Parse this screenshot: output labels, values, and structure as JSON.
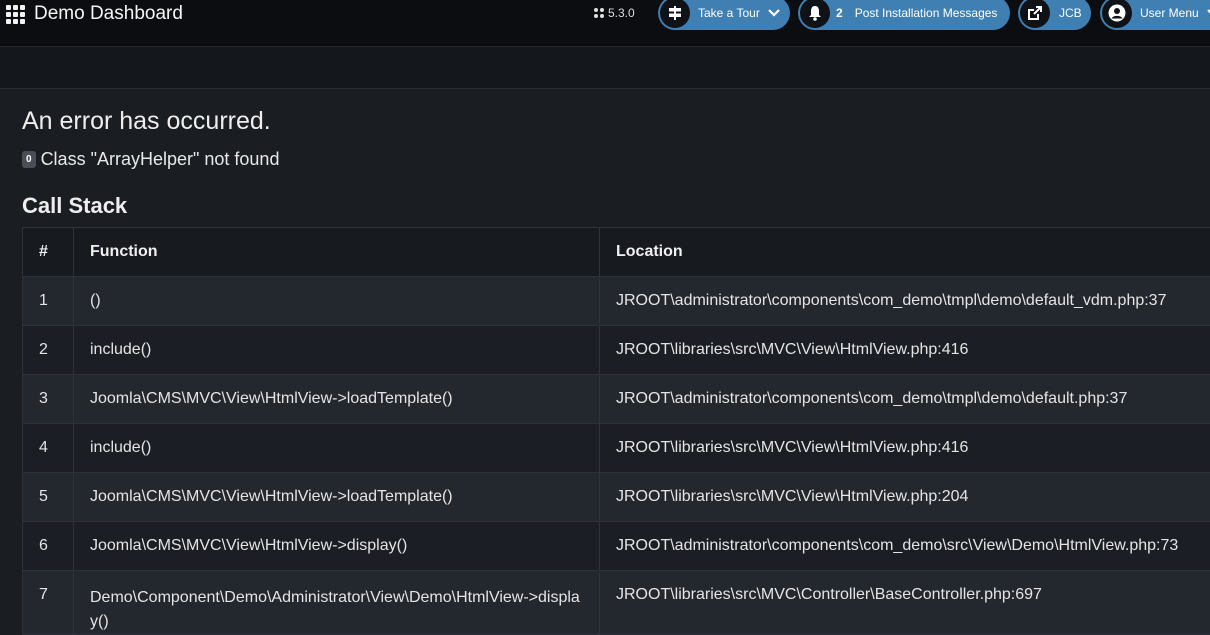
{
  "header": {
    "title": "Demo Dashboard",
    "version": "5.3.0",
    "tour_label": "Take a Tour",
    "messages_count": "2",
    "messages_label": "Post Installation Messages",
    "jcb_label": "JCB",
    "user_menu_label": "User Menu"
  },
  "error": {
    "title": "An error has occurred.",
    "code": "0",
    "message": "Class \"ArrayHelper\" not found"
  },
  "call_stack": {
    "title": "Call Stack",
    "columns": [
      "#",
      "Function",
      "Location"
    ],
    "rows": [
      {
        "n": "1",
        "function": "()",
        "location": "JROOT\\administrator\\components\\com_demo\\tmpl\\demo\\default_vdm.php:37"
      },
      {
        "n": "2",
        "function": "include()",
        "location": "JROOT\\libraries\\src\\MVC\\View\\HtmlView.php:416"
      },
      {
        "n": "3",
        "function": "Joomla\\CMS\\MVC\\View\\HtmlView->loadTemplate()",
        "location": "JROOT\\administrator\\components\\com_demo\\tmpl\\demo\\default.php:37"
      },
      {
        "n": "4",
        "function": "include()",
        "location": "JROOT\\libraries\\src\\MVC\\View\\HtmlView.php:416"
      },
      {
        "n": "5",
        "function": "Joomla\\CMS\\MVC\\View\\HtmlView->loadTemplate()",
        "location": "JROOT\\libraries\\src\\MVC\\View\\HtmlView.php:204"
      },
      {
        "n": "6",
        "function": "Joomla\\CMS\\MVC\\View\\HtmlView->display()",
        "location": "JROOT\\administrator\\components\\com_demo\\src\\View\\Demo\\HtmlView.php:73"
      },
      {
        "n": "7",
        "function": "Demo\\Component\\Demo\\Administrator\\View\\Demo\\HtmlView->display()",
        "location": "JROOT\\libraries\\src\\MVC\\Controller\\BaseController.php:697"
      }
    ]
  },
  "icons": {
    "menu": "grid-icon",
    "joomla": "joomla-icon",
    "tour": "signpost-icon",
    "chevron": "chevron-down-icon",
    "bell": "bell-icon",
    "external": "external-link-icon",
    "user": "user-icon"
  },
  "colors": {
    "accent": "#3f7fb1",
    "background": "#1a1d22"
  }
}
